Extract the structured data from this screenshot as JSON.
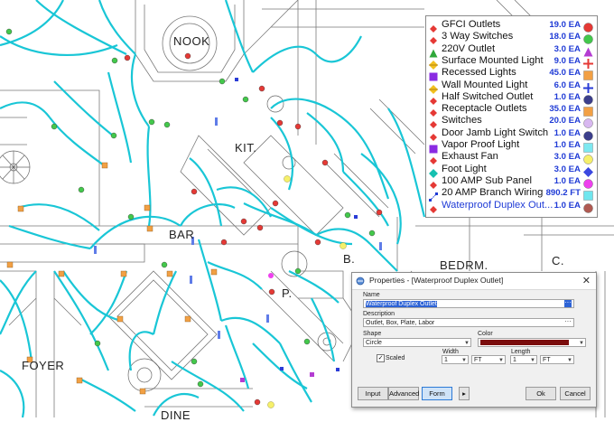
{
  "rooms": {
    "nook": "NOOK",
    "kit": "KIT.",
    "bar": "BAR",
    "b": "B.",
    "p": "P.",
    "bedrm": "BEDRM.",
    "c": "C.",
    "foyer": "FOYER",
    "dine": "DINE"
  },
  "legend": {
    "items": [
      {
        "label": "GFCI Outlets",
        "qty": "19.0 EA",
        "symbol": "gfci-outlet-icon",
        "mark": "red-circle-icon",
        "color": "#e53935"
      },
      {
        "label": "3 Way Switches",
        "qty": "18.0 EA",
        "symbol": "three-way-switch-icon",
        "mark": "green-circle-icon",
        "color": "#43c84b"
      },
      {
        "label": "220V Outlet",
        "qty": "3.0 EA",
        "symbol": "green-triangle-icon",
        "mark": "purple-triangle-icon",
        "color": "#b43cd2"
      },
      {
        "label": "Surface Mounted Light",
        "qty": "9.0 EA",
        "symbol": "surface-light-icon",
        "mark": "red-plus-icon",
        "color": "#e53935"
      },
      {
        "label": "Recessed Lights",
        "qty": "45.0 EA",
        "symbol": "purple-square-icon",
        "mark": "orange-square-icon",
        "color": "#f2a044"
      },
      {
        "label": "Wall Mounted Light",
        "qty": "6.0 EA",
        "symbol": "wall-light-icon",
        "mark": "blue-plus-icon",
        "color": "#2a3cd6"
      },
      {
        "label": "Half Switched Outlet",
        "qty": "1.0 EA",
        "symbol": "half-switched-outlet-icon",
        "mark": "navy-circle-icon",
        "color": "#3c3f8c"
      },
      {
        "label": "Receptacle Outlets",
        "qty": "35.0 EA",
        "symbol": "receptacle-outlet-icon",
        "mark": "orange-square-icon",
        "color": "#f2a044"
      },
      {
        "label": "Switches",
        "qty": "20.0 EA",
        "symbol": "switch-icon",
        "mark": "lavender-circle-icon",
        "color": "#d8b8f0"
      },
      {
        "label": "Door Jamb Light Switch",
        "qty": "1.0 EA",
        "symbol": "door-jamb-switch-icon",
        "mark": "navy-circle-icon",
        "color": "#3c3f8c"
      },
      {
        "label": "Vapor Proof Light",
        "qty": "1.0 EA",
        "symbol": "purple-square-icon",
        "mark": "cyan-square-icon",
        "color": "#7de8f0"
      },
      {
        "label": "Exhaust Fan",
        "qty": "3.0 EA",
        "symbol": "exhaust-fan-icon",
        "mark": "yellow-circle-icon",
        "color": "#f6f06a"
      },
      {
        "label": "Foot Light",
        "qty": "3.0 EA",
        "symbol": "teal-diamond-icon",
        "mark": "blue-diamond-icon",
        "color": "#3b48e0"
      },
      {
        "label": "100 AMP Sub Panel",
        "qty": "1.0 EA",
        "symbol": "sub-panel-icon",
        "mark": "magenta-circle-icon",
        "color": "#ee40ee"
      },
      {
        "label": "20 AMP Branch Wiring",
        "qty": "890.2 FT",
        "symbol": "branch-wiring-icon",
        "mark": "cyan-square-icon",
        "color": "#6fe6ee"
      },
      {
        "label": "Waterproof Duplex Out...",
        "qty": "1.0 EA",
        "symbol": "waterproof-outlet-icon",
        "mark": "brown-circle-icon",
        "color": "#b05a52"
      }
    ]
  },
  "dialog": {
    "title": "Properties - [Waterproof Duplex Outlet]",
    "name_label": "Name",
    "name_value": "Waterproof Duplex Outlet",
    "description_label": "Description",
    "description_value": "Outlet, Box, Plate, Labor",
    "shape_label": "Shape",
    "shape_value": "Circle",
    "color_label": "Color",
    "color_value": "#7a0c0c",
    "scaled_label": "Scaled",
    "width_label": "Width",
    "width_value": "1",
    "width_unit": "FT",
    "length_label": "Length",
    "length_value": "1",
    "length_unit": "FT",
    "buttons": {
      "input": "Input",
      "advanced": "Advanced",
      "form": "Form",
      "ok": "Ok",
      "cancel": "Cancel"
    }
  },
  "colors": {
    "wire": "#19c6d6",
    "plan_line": "#6b6b6b",
    "legend_qty": "#1f3bd6"
  }
}
